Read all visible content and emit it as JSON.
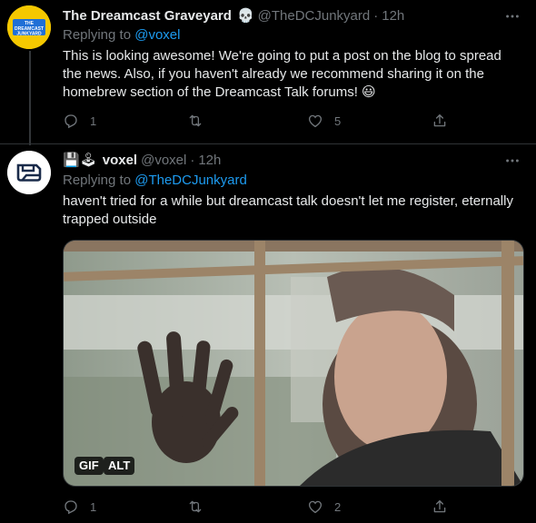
{
  "tweets": [
    {
      "display_name": "The Dreamcast Graveyard",
      "name_emoji": "💀",
      "handle": "@TheDCJunkyard",
      "separator": "·",
      "time": "12h",
      "replying_prefix": "Replying to",
      "replying_to": "@voxel",
      "text": "This is looking awesome! We're going to put a post on the blog to spread the news. Also, if you haven't already we recommend sharing it on the homebrew section of the Dreamcast Talk forums!",
      "trailing_emoji": "😃",
      "avatar_text": [
        "THE",
        "DREAMCAST",
        "JUNKYARD"
      ],
      "replies": "1",
      "retweets": "",
      "likes": "5"
    },
    {
      "display_name": "voxel",
      "name_emoji": "💾🕹",
      "handle": "@voxel",
      "separator": "·",
      "time": "12h",
      "replying_prefix": "Replying to",
      "replying_to": "@TheDCJunkyard",
      "text": "haven't tried for a while but dreamcast talk doesn't let me register, eternally trapped outside",
      "media": {
        "badge_gif": "GIF",
        "badge_alt": "ALT"
      },
      "replies": "1",
      "retweets": "",
      "likes": "2"
    }
  ],
  "icons": {
    "reply": "reply-icon",
    "retweet": "retweet-icon",
    "like": "like-icon",
    "share": "share-icon",
    "more": "more-icon"
  },
  "colors": {
    "background": "#000000",
    "text": "#e7e9ea",
    "muted": "#71767b",
    "link": "#1d9bf0",
    "avatar_yellow": "#f5c800"
  }
}
